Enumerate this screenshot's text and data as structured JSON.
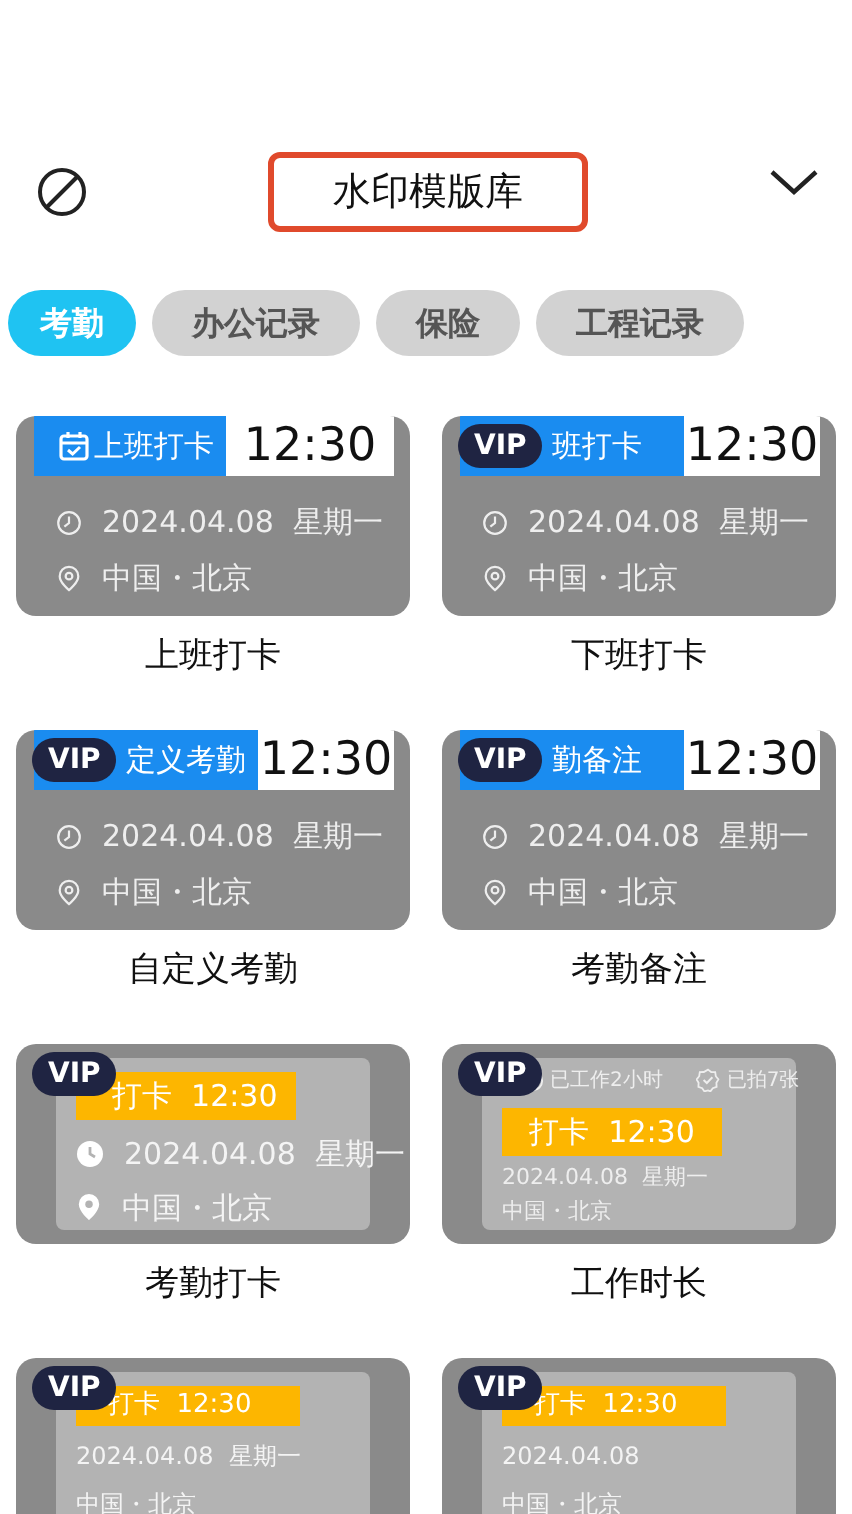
{
  "header": {
    "title": "水印模版库"
  },
  "tabs": [
    {
      "label": "考勤",
      "selected": true
    },
    {
      "label": "办公记录",
      "selected": false
    },
    {
      "label": "保险",
      "selected": false
    },
    {
      "label": "工程记录",
      "selected": false
    }
  ],
  "templates": [
    {
      "kind": "banner",
      "header_label": "上班打卡",
      "time": "12:30",
      "date": "2024.04.08  星期一",
      "location": "中国・北京",
      "name": "上班打卡"
    },
    {
      "kind": "banner",
      "vip": "VIP",
      "header_label": "班打卡",
      "time": "12:30",
      "date": "2024.04.08  星期一",
      "location": "中国・北京",
      "name": "下班打卡"
    },
    {
      "kind": "banner",
      "vip": "VIP",
      "header_label": "定义考勤",
      "time": "12:30",
      "date": "2024.04.08  星期一",
      "location": "中国・北京",
      "name": "自定义考勤"
    },
    {
      "kind": "banner",
      "vip": "VIP",
      "header_label": "勤备注",
      "time": "12:30",
      "date": "2024.04.08  星期一",
      "location": "中国・北京",
      "name": "考勤备注"
    },
    {
      "kind": "stamp",
      "vip": "VIP",
      "punch": "打卡  12:30",
      "date": "2024.04.08  星期一",
      "location": "中国・北京",
      "name": "考勤打卡"
    },
    {
      "kind": "duration",
      "vip": "VIP",
      "worked": "已工作2小时",
      "photos": "已拍7张",
      "punch": "打卡  12:30",
      "date": "2024.04.08  星期一",
      "location": "中国・北京",
      "name": "工作时长"
    },
    {
      "kind": "plain",
      "vip": "VIP",
      "punch": "打卡  12:30",
      "date": "2024.04.08  星期一",
      "location": "中国・北京"
    },
    {
      "kind": "plain",
      "vip": "VIP",
      "punch": "打卡  12:30",
      "date": "2024.04.08",
      "location": "中国・北京"
    }
  ]
}
